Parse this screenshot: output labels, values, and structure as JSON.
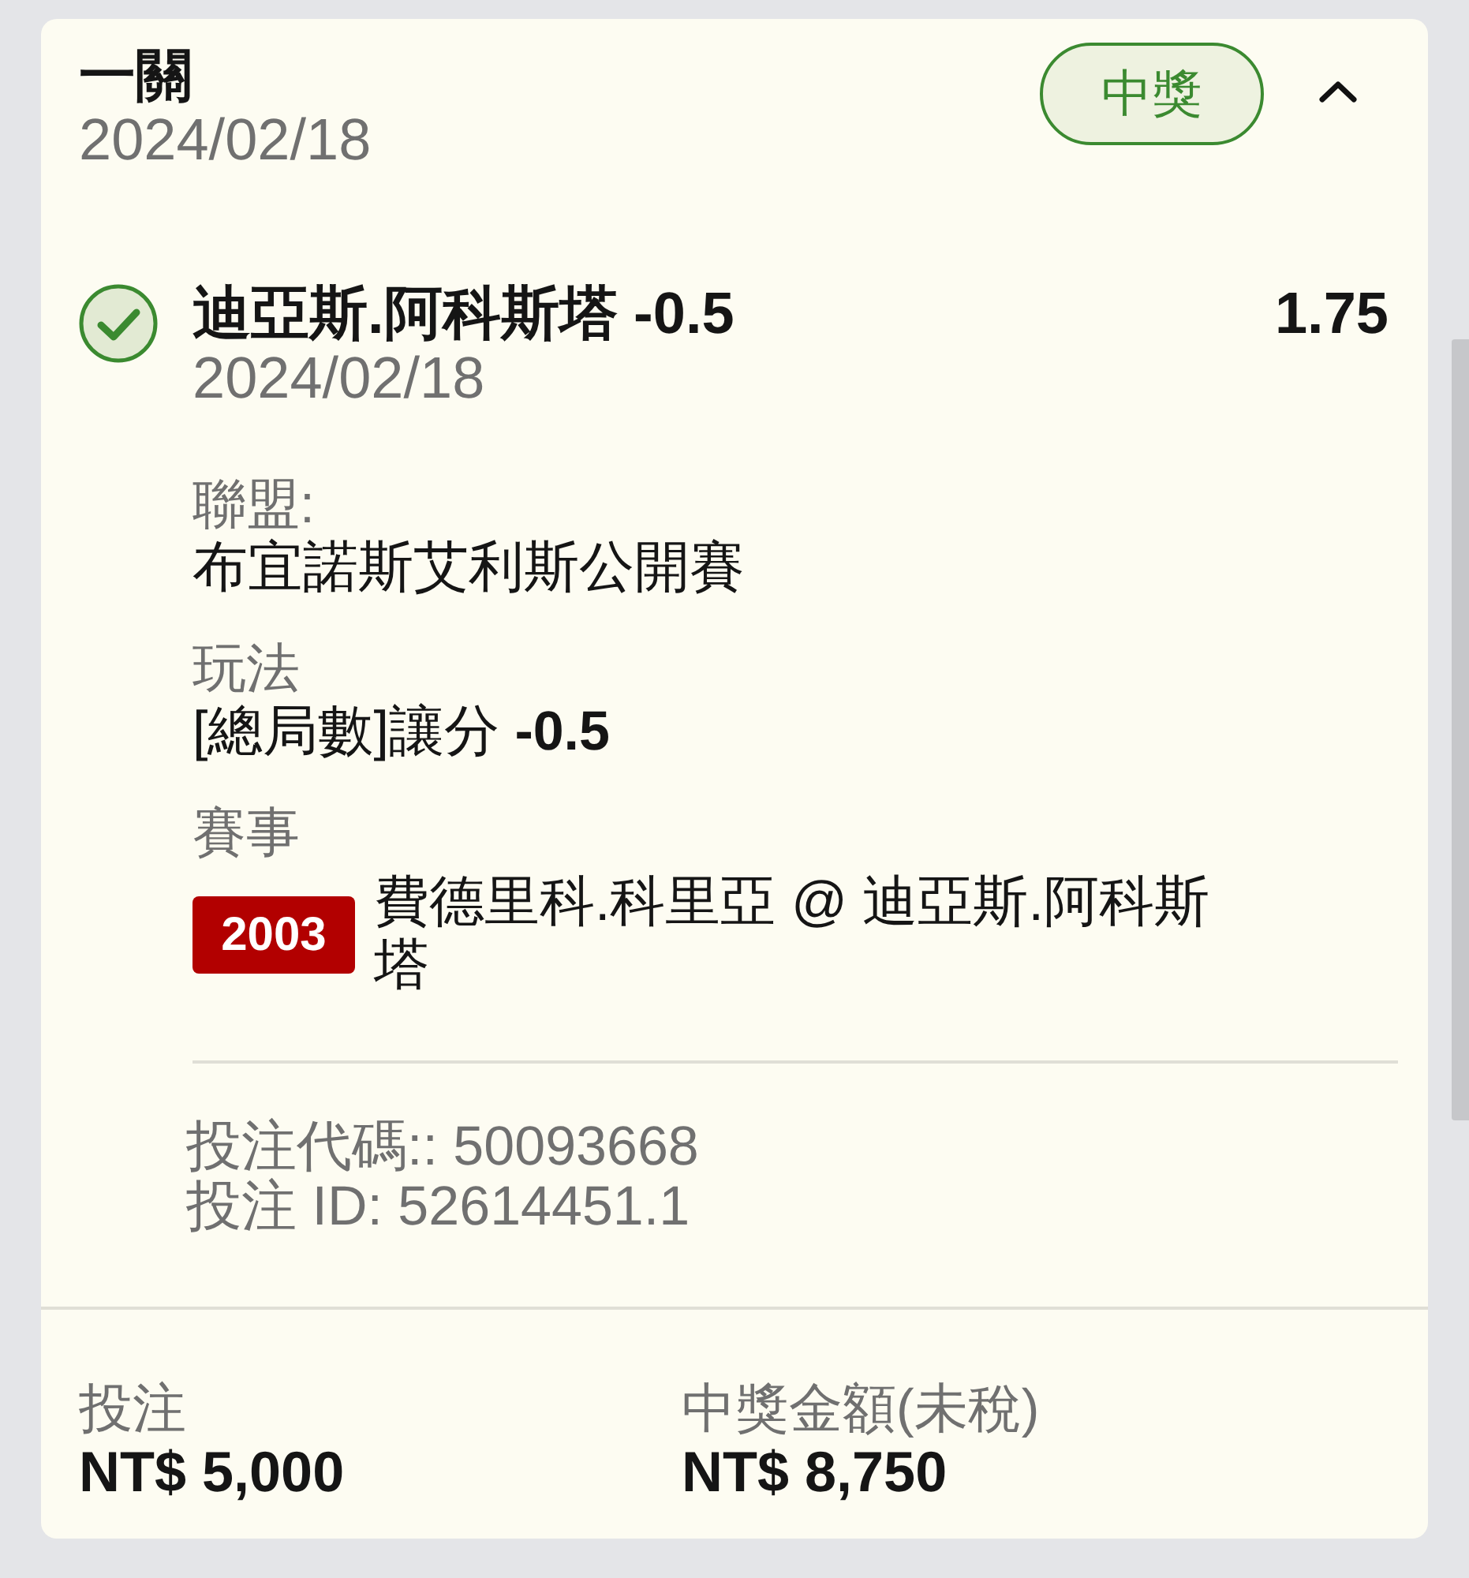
{
  "bet_slip": {
    "title": "一關",
    "date": "2024/02/18",
    "status_badge": "中獎",
    "expanded": true
  },
  "selection": {
    "won": true,
    "title": "迪亞斯.阿科斯塔 -0.5",
    "odds": "1.75",
    "date": "2024/02/18",
    "details": [
      {
        "kind": "text",
        "label": "聯盟:",
        "value": "布宜諾斯艾利斯公開賽"
      },
      {
        "kind": "text",
        "label": "玩法",
        "value": "[總局數]讓分 **-0.5**"
      },
      {
        "kind": "event",
        "label": "賽事",
        "event_number": "2003",
        "value": "費德里科.科里亞 @ 迪亞斯.阿科斯塔"
      }
    ],
    "bet_code": "投注代碼:: 50093668",
    "bet_id": "投注 ID: 52614451.1"
  },
  "totals": [
    {
      "label": "投注",
      "value": "NT$ 5,000"
    },
    {
      "label": "中獎金額(未稅)",
      "value": "NT$ 8,750"
    }
  ]
}
